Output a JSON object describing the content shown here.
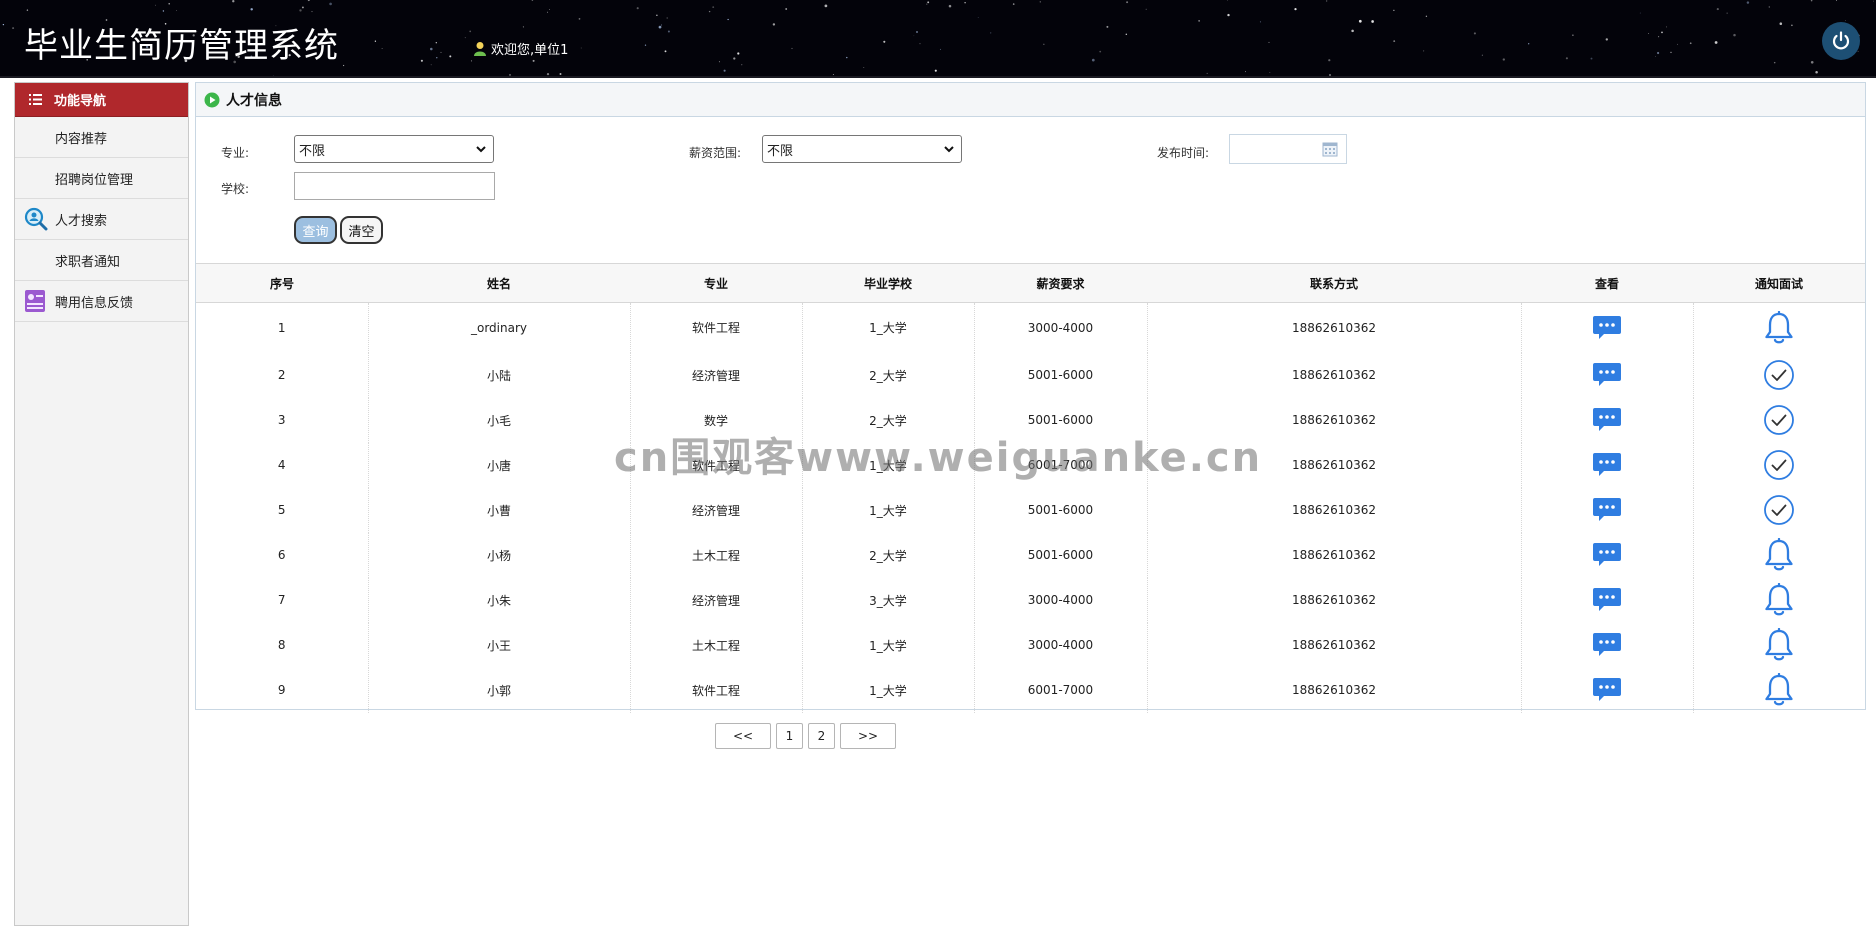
{
  "header": {
    "app_title": "毕业生简历管理系统",
    "welcome_text": "欢迎您,单位1"
  },
  "sidebar": {
    "title": "功能导航",
    "items": [
      {
        "label": "内容推荐",
        "icon": ""
      },
      {
        "label": "招聘岗位管理",
        "icon": ""
      },
      {
        "label": "人才搜索",
        "icon": "search-person-icon"
      },
      {
        "label": "求职者通知",
        "icon": ""
      },
      {
        "label": "聘用信息反馈",
        "icon": "resume-card-icon"
      }
    ]
  },
  "panel": {
    "title": "人才信息"
  },
  "filters": {
    "major_label": "专业:",
    "major_value": "不限",
    "salary_label": "薪资范围:",
    "salary_value": "不限",
    "publish_time_label": "发布时间:",
    "school_label": "学校:",
    "school_value": "",
    "query_label": "查询",
    "clear_label": "清空"
  },
  "table": {
    "columns": [
      "序号",
      "姓名",
      "专业",
      "毕业学校",
      "薪资要求",
      "联系方式",
      "查看",
      "通知面试"
    ],
    "rows": [
      {
        "no": "1",
        "name": "_ordinary",
        "major": "软件工程",
        "school": "1_大学",
        "salary": "3000-4000",
        "contact": "18862610362",
        "notify_state": "bell"
      },
      {
        "no": "2",
        "name": "小陆",
        "major": "经济管理",
        "school": "2_大学",
        "salary": "5001-6000",
        "contact": "18862610362",
        "notify_state": "check"
      },
      {
        "no": "3",
        "name": "小毛",
        "major": "数学",
        "school": "2_大学",
        "salary": "5001-6000",
        "contact": "18862610362",
        "notify_state": "check"
      },
      {
        "no": "4",
        "name": "小唐",
        "major": "软件工程",
        "school": "1_大学",
        "salary": "6001-7000",
        "contact": "18862610362",
        "notify_state": "check"
      },
      {
        "no": "5",
        "name": "小曹",
        "major": "经济管理",
        "school": "1_大学",
        "salary": "5001-6000",
        "contact": "18862610362",
        "notify_state": "check"
      },
      {
        "no": "6",
        "name": "小杨",
        "major": "土木工程",
        "school": "2_大学",
        "salary": "5001-6000",
        "contact": "18862610362",
        "notify_state": "bell"
      },
      {
        "no": "7",
        "name": "小朱",
        "major": "经济管理",
        "school": "3_大学",
        "salary": "3000-4000",
        "contact": "18862610362",
        "notify_state": "bell"
      },
      {
        "no": "8",
        "name": "小王",
        "major": "土木工程",
        "school": "1_大学",
        "salary": "3000-4000",
        "contact": "18862610362",
        "notify_state": "bell"
      },
      {
        "no": "9",
        "name": "小郭",
        "major": "软件工程",
        "school": "1_大学",
        "salary": "6001-7000",
        "contact": "18862610362",
        "notify_state": "bell"
      }
    ]
  },
  "pagination": {
    "prev": "<<",
    "pages": [
      "1",
      "2"
    ],
    "next": ">>"
  },
  "watermark": "cn围观客www.weiguanke.cn",
  "colors": {
    "header_bg": "#03030a",
    "sidebar_active": "#b0282c",
    "icon_blue": "#2f7de1",
    "power_bg": "#1d4f74"
  }
}
